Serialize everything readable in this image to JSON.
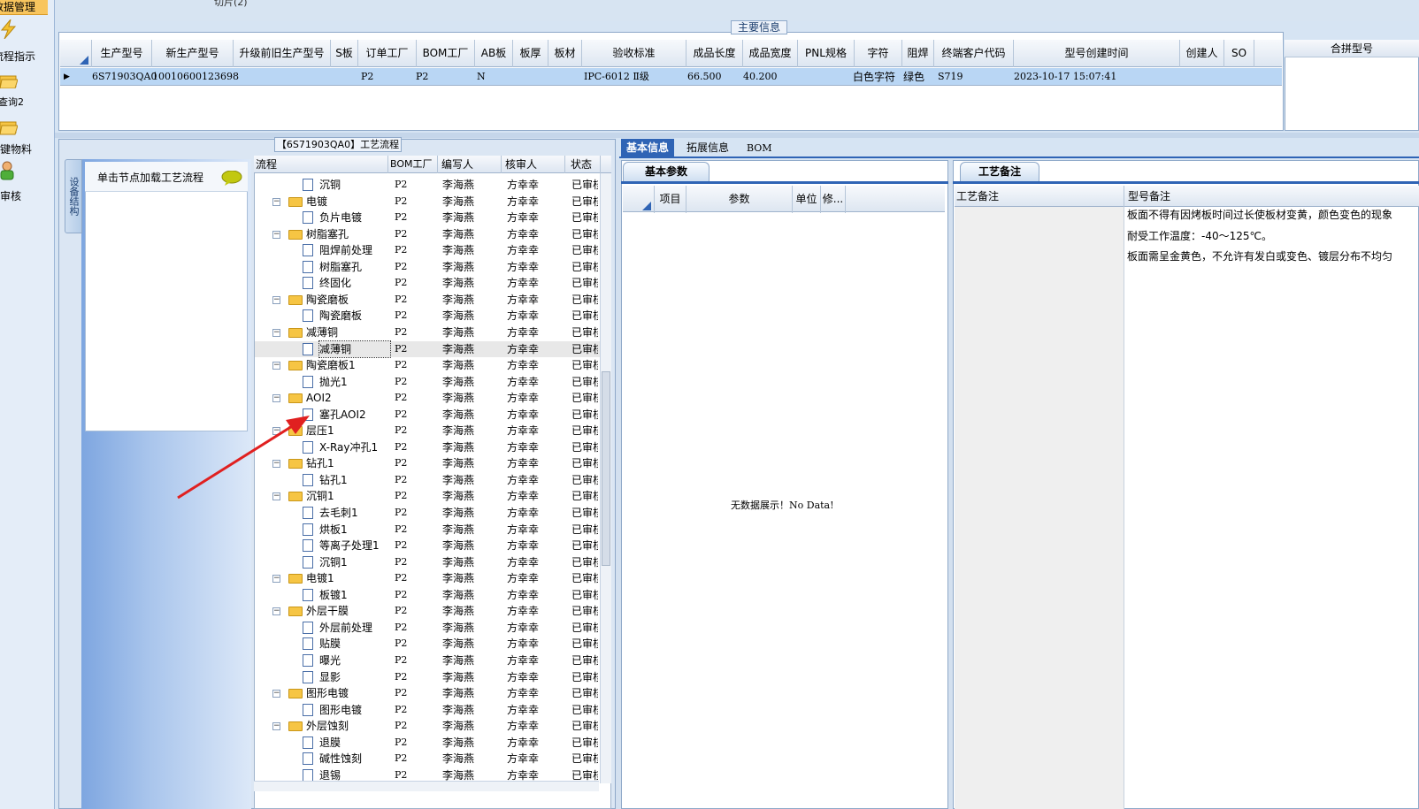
{
  "nav": {
    "header": "数据管理",
    "items": [
      {
        "label": "流程指示",
        "icon": "lightning-icon"
      },
      {
        "label": "查询2",
        "icon": "folder-open-icon"
      },
      {
        "label": "关键物料",
        "icon": "folder-open-icon"
      },
      {
        "label": "单审核",
        "icon": "user-icon"
      }
    ]
  },
  "top_tab_text": "切片(2)",
  "main_info": {
    "legend": "主要信息",
    "columns": [
      "生产型号",
      "新生产型号",
      "升级前旧生产型号",
      "S板",
      "订单工厂",
      "BOM工厂",
      "AB板",
      "板厚",
      "板材",
      "验收标准",
      "成品长度",
      "成品宽度",
      "PNL规格",
      "字符",
      "阻焊",
      "终端客户代码",
      "型号创建时间",
      "创建人",
      "SO"
    ],
    "row": {
      "prod_model": "6S71903QA0",
      "new_model": "10010600123698",
      "order_factory": "P2",
      "bom_factory": "P2",
      "ab": "N",
      "standard": "IPC-6012 Ⅱ级",
      "length": "66.500",
      "width": "40.200",
      "char": "白色字符",
      "solder": "绿色",
      "customer": "S719",
      "created": "2023-10-17 15:07:41"
    },
    "merge_header": "合拼型号"
  },
  "process": {
    "legend": "【6S71903QA0】工艺流程",
    "side_tab": "设备结构",
    "load_hint": "单击节点加载工艺流程",
    "columns": [
      "流程",
      "BOM工厂",
      "编写人",
      "核审人",
      "状态"
    ],
    "rows": [
      {
        "name": "沉铜",
        "type": "doc",
        "bom": "P2",
        "writer": "李海燕",
        "reviewer": "方幸幸",
        "status": "已审核"
      },
      {
        "name": "电镀",
        "type": "folder",
        "bom": "P2",
        "writer": "李海燕",
        "reviewer": "方幸幸",
        "status": "已审核"
      },
      {
        "name": "负片电镀",
        "type": "doc",
        "bom": "P2",
        "writer": "李海燕",
        "reviewer": "方幸幸",
        "status": "已审核"
      },
      {
        "name": "树脂塞孔",
        "type": "folder",
        "bom": "P2",
        "writer": "李海燕",
        "reviewer": "方幸幸",
        "status": "已审核"
      },
      {
        "name": "阻焊前处理",
        "type": "doc",
        "bom": "P2",
        "writer": "李海燕",
        "reviewer": "方幸幸",
        "status": "已审核"
      },
      {
        "name": "树脂塞孔",
        "type": "doc",
        "bom": "P2",
        "writer": "李海燕",
        "reviewer": "方幸幸",
        "status": "已审核"
      },
      {
        "name": "终固化",
        "type": "doc",
        "bom": "P2",
        "writer": "李海燕",
        "reviewer": "方幸幸",
        "status": "已审核"
      },
      {
        "name": "陶瓷磨板",
        "type": "folder",
        "bom": "P2",
        "writer": "李海燕",
        "reviewer": "方幸幸",
        "status": "已审核"
      },
      {
        "name": "陶瓷磨板",
        "type": "doc",
        "bom": "P2",
        "writer": "李海燕",
        "reviewer": "方幸幸",
        "status": "已审核"
      },
      {
        "name": "减薄铜",
        "type": "folder",
        "bom": "P2",
        "writer": "李海燕",
        "reviewer": "方幸幸",
        "status": "已审核"
      },
      {
        "name": "减薄铜",
        "type": "doc",
        "bom": "P2",
        "writer": "李海燕",
        "reviewer": "方幸幸",
        "status": "已审核",
        "selected": true
      },
      {
        "name": "陶瓷磨板1",
        "type": "folder",
        "bom": "P2",
        "writer": "李海燕",
        "reviewer": "方幸幸",
        "status": "已审核"
      },
      {
        "name": "抛光1",
        "type": "doc",
        "bom": "P2",
        "writer": "李海燕",
        "reviewer": "方幸幸",
        "status": "已审核"
      },
      {
        "name": "AOI2",
        "type": "folder",
        "bom": "P2",
        "writer": "李海燕",
        "reviewer": "方幸幸",
        "status": "已审核"
      },
      {
        "name": "塞孔AOI2",
        "type": "doc",
        "bom": "P2",
        "writer": "李海燕",
        "reviewer": "方幸幸",
        "status": "已审核"
      },
      {
        "name": "层压1",
        "type": "folder",
        "bom": "P2",
        "writer": "李海燕",
        "reviewer": "方幸幸",
        "status": "已审核"
      },
      {
        "name": "X-Ray冲孔1",
        "type": "doc",
        "bom": "P2",
        "writer": "李海燕",
        "reviewer": "方幸幸",
        "status": "已审核"
      },
      {
        "name": "钻孔1",
        "type": "folder",
        "bom": "P2",
        "writer": "李海燕",
        "reviewer": "方幸幸",
        "status": "已审核"
      },
      {
        "name": "钻孔1",
        "type": "doc",
        "bom": "P2",
        "writer": "李海燕",
        "reviewer": "方幸幸",
        "status": "已审核"
      },
      {
        "name": "沉铜1",
        "type": "folder",
        "bom": "P2",
        "writer": "李海燕",
        "reviewer": "方幸幸",
        "status": "已审核"
      },
      {
        "name": "去毛刺1",
        "type": "doc",
        "bom": "P2",
        "writer": "李海燕",
        "reviewer": "方幸幸",
        "status": "已审核"
      },
      {
        "name": "烘板1",
        "type": "doc",
        "bom": "P2",
        "writer": "李海燕",
        "reviewer": "方幸幸",
        "status": "已审核"
      },
      {
        "name": "等离子处理1",
        "type": "doc",
        "bom": "P2",
        "writer": "李海燕",
        "reviewer": "方幸幸",
        "status": "已审核"
      },
      {
        "name": "沉铜1",
        "type": "doc",
        "bom": "P2",
        "writer": "李海燕",
        "reviewer": "方幸幸",
        "status": "已审核"
      },
      {
        "name": "电镀1",
        "type": "folder",
        "bom": "P2",
        "writer": "李海燕",
        "reviewer": "方幸幸",
        "status": "已审核"
      },
      {
        "name": "板镀1",
        "type": "doc",
        "bom": "P2",
        "writer": "李海燕",
        "reviewer": "方幸幸",
        "status": "已审核"
      },
      {
        "name": "外层干膜",
        "type": "folder",
        "bom": "P2",
        "writer": "李海燕",
        "reviewer": "方幸幸",
        "status": "已审核"
      },
      {
        "name": "外层前处理",
        "type": "doc",
        "bom": "P2",
        "writer": "李海燕",
        "reviewer": "方幸幸",
        "status": "已审核"
      },
      {
        "name": "贴膜",
        "type": "doc",
        "bom": "P2",
        "writer": "李海燕",
        "reviewer": "方幸幸",
        "status": "已审核"
      },
      {
        "name": "曝光",
        "type": "doc",
        "bom": "P2",
        "writer": "李海燕",
        "reviewer": "方幸幸",
        "status": "已审核"
      },
      {
        "name": "显影",
        "type": "doc",
        "bom": "P2",
        "writer": "李海燕",
        "reviewer": "方幸幸",
        "status": "已审核"
      },
      {
        "name": "图形电镀",
        "type": "folder",
        "bom": "P2",
        "writer": "李海燕",
        "reviewer": "方幸幸",
        "status": "已审核"
      },
      {
        "name": "图形电镀",
        "type": "doc",
        "bom": "P2",
        "writer": "李海燕",
        "reviewer": "方幸幸",
        "status": "已审核"
      },
      {
        "name": "外层蚀刻",
        "type": "folder",
        "bom": "P2",
        "writer": "李海燕",
        "reviewer": "方幸幸",
        "status": "已审核"
      },
      {
        "name": "退膜",
        "type": "doc",
        "bom": "P2",
        "writer": "李海燕",
        "reviewer": "方幸幸",
        "status": "已审核"
      },
      {
        "name": "碱性蚀刻",
        "type": "doc",
        "bom": "P2",
        "writer": "李海燕",
        "reviewer": "方幸幸",
        "status": "已审核"
      },
      {
        "name": "退锡",
        "type": "doc",
        "bom": "P2",
        "writer": "李海燕",
        "reviewer": "方幸幸",
        "status": "已审核"
      }
    ]
  },
  "tabs": [
    "基本信息",
    "拓展信息",
    "BOM"
  ],
  "basic": {
    "subtab": "基本参数",
    "columns": [
      "项目",
      "参数",
      "单位",
      "修..."
    ],
    "empty_text": "无数据展示！No Data!"
  },
  "notes": {
    "subtab": "工艺备注",
    "col1": "工艺备注",
    "col2": "型号备注",
    "lines": [
      "板面不得有因烤板时间过长使板材变黄，颜色变色的现象",
      "耐受工作温度：-40～125℃。",
      "板面需呈金黄色，不允许有发白或变色、镀层分布不均匀"
    ]
  },
  "colors": {
    "accent": "#2f64b5",
    "selection": "#b9d6f4",
    "arrow": "#e02020"
  }
}
